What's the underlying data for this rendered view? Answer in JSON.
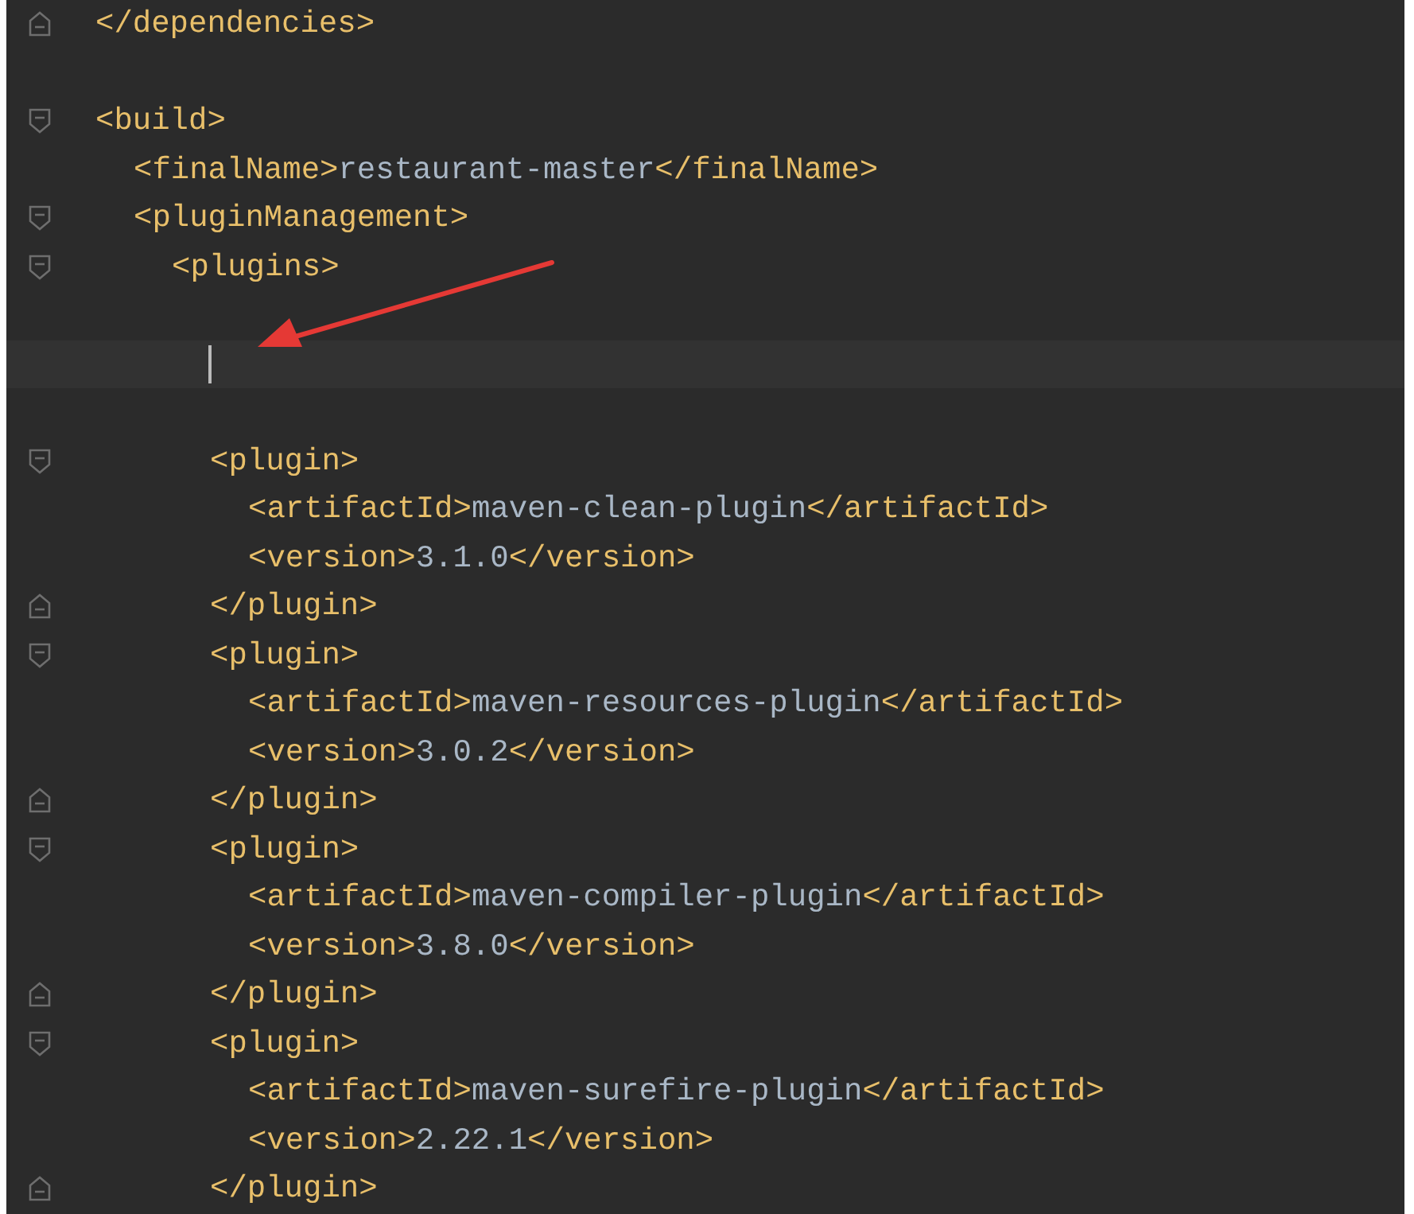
{
  "editor": {
    "lines": [
      {
        "text": "</dependencies>",
        "kind": "fold_end",
        "current": false
      },
      {
        "current": false
      },
      {
        "text": "<build>",
        "kind": "fold_start",
        "current": false,
        "children": [
          {
            "text": "<finalName>restaurant-master</finalName>",
            "current": false
          },
          {
            "text": "<pluginManagement>",
            "kind": "fold_start",
            "current": false,
            "children": [
              {
                "text": "<plugins>",
                "kind": "fold_start",
                "current": false,
                "children": [
                  {
                    "current": false
                  },
                  {
                    "current": true
                  },
                  {
                    "current": false
                  },
                  {
                    "text": "<plugin>",
                    "kind": "fold_start",
                    "current": false,
                    "children": [
                      {
                        "text": "<artifactId>maven-clean-plugin</artifactId>",
                        "current": false
                      },
                      {
                        "text": "<version>3.1.0</version>",
                        "current": false
                      }
                    ]
                  },
                  {
                    "text": "</plugin>",
                    "kind": "fold_end",
                    "current": false
                  },
                  {
                    "text": "<plugin>",
                    "kind": "fold_start",
                    "current": false,
                    "children": [
                      {
                        "text": "<artifactId>maven-resources-plugin</artifactId>",
                        "current": false
                      },
                      {
                        "text": "<version>3.0.2</version>",
                        "current": false
                      }
                    ]
                  },
                  {
                    "text": "</plugin>",
                    "kind": "fold_end",
                    "current": false
                  },
                  {
                    "text": "<plugin>",
                    "kind": "fold_start",
                    "current": false,
                    "children": [
                      {
                        "text": "<artifactId>maven-compiler-plugin</artifactId>",
                        "current": false
                      },
                      {
                        "text": "<version>3.8.0</version>",
                        "current": false
                      }
                    ]
                  },
                  {
                    "text": "</plugin>",
                    "kind": "fold_end",
                    "current": false
                  },
                  {
                    "text": "<plugin>",
                    "kind": "fold_start",
                    "current": false,
                    "children": [
                      {
                        "text": "<artifactId>maven-surefire-plugin</artifactId>",
                        "current": false
                      },
                      {
                        "text": "<version>2.22.1</version>",
                        "current": false
                      }
                    ]
                  },
                  {
                    "text": "</plugin>",
                    "kind": "fold_end",
                    "current": false
                  }
                ]
              }
            ]
          }
        ]
      }
    ]
  }
}
